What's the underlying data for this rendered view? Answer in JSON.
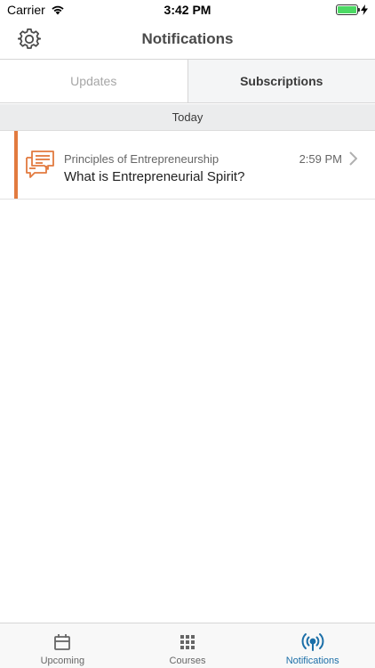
{
  "status_bar": {
    "carrier": "Carrier",
    "time": "3:42 PM",
    "battery_level": 1.0
  },
  "nav": {
    "title": "Notifications",
    "settings_icon": "gear-icon"
  },
  "tabs": [
    {
      "label": "Updates",
      "selected": false
    },
    {
      "label": "Subscriptions",
      "selected": true
    }
  ],
  "section": {
    "header": "Today"
  },
  "notifications": [
    {
      "course": "Principles of Entrepreneurship",
      "title": "What is Entrepreneurial Spirit?",
      "time": "2:59 PM",
      "icon": "discussion-icon",
      "accent_color": "#e27a3f"
    }
  ],
  "tab_bar": {
    "items": [
      {
        "label": "Upcoming",
        "icon": "calendar-icon",
        "active": false
      },
      {
        "label": "Courses",
        "icon": "grid-icon",
        "active": false
      },
      {
        "label": "Notifications",
        "icon": "broadcast-icon",
        "active": true
      }
    ],
    "active_color": "#1c6fa8"
  }
}
